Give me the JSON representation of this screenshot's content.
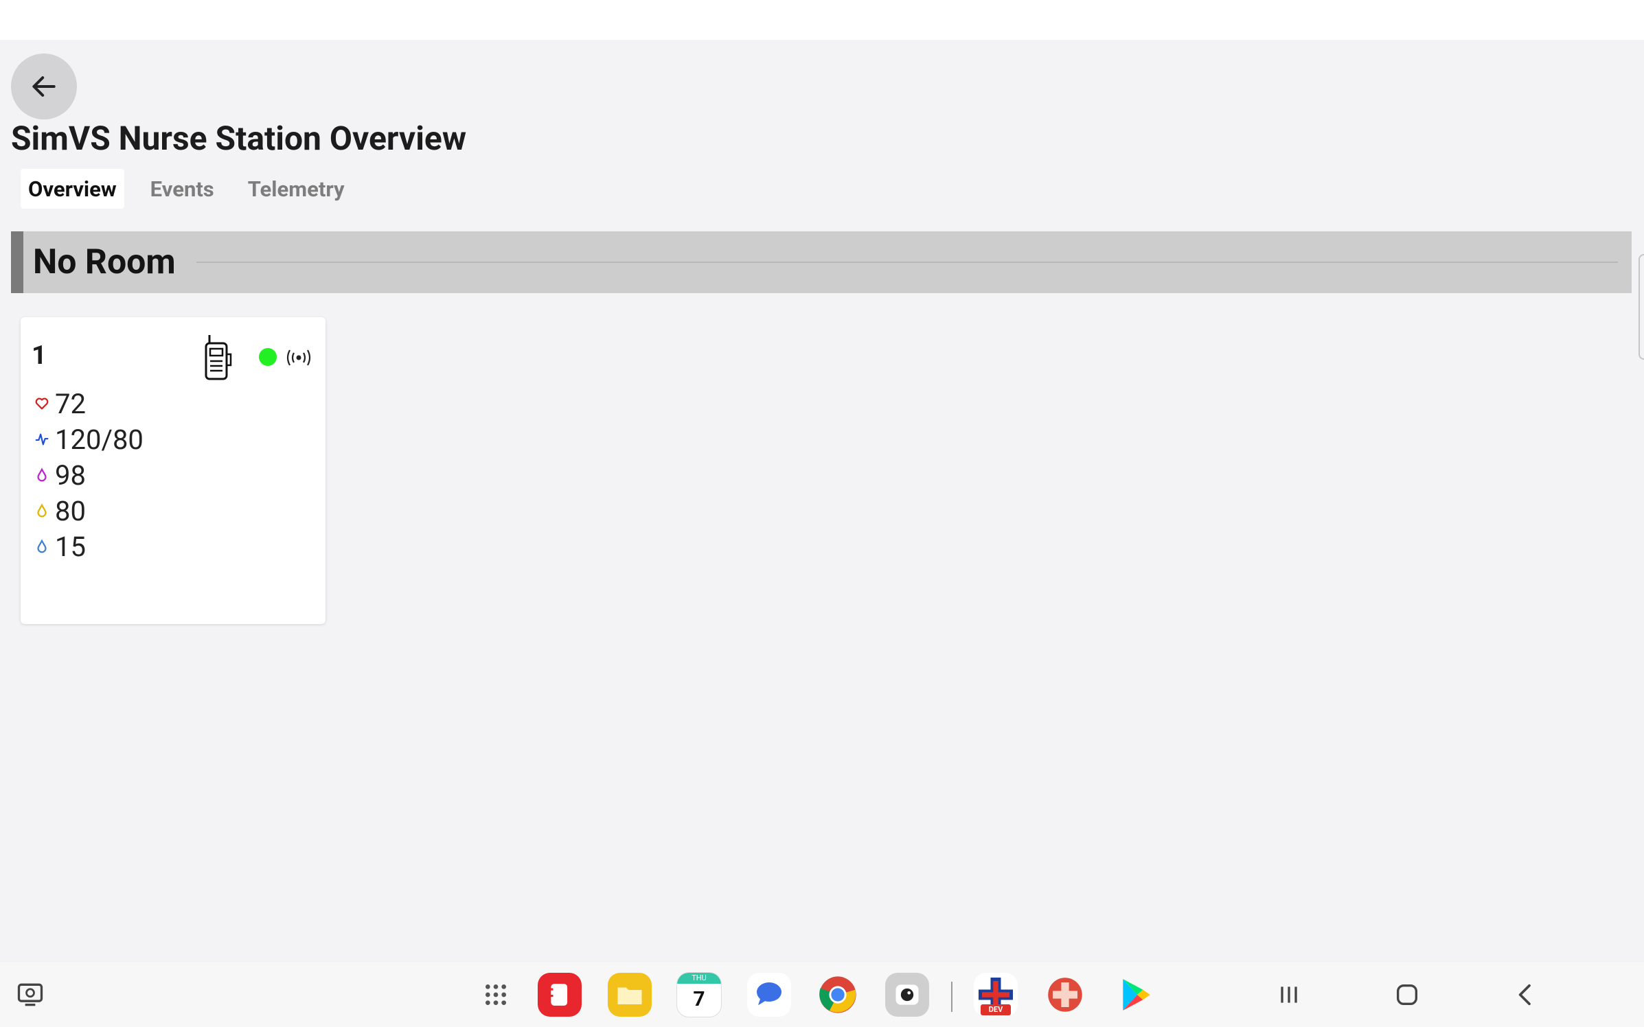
{
  "page": {
    "title": "SimVS Nurse Station Overview"
  },
  "tabs": [
    {
      "label": "Overview",
      "active": true
    },
    {
      "label": "Events",
      "active": false
    },
    {
      "label": "Telemetry",
      "active": false
    }
  ],
  "room": {
    "title": "No Room"
  },
  "patient_card": {
    "id": "1",
    "status_color": "#22f022",
    "device_icon": "telemetry-device-icon",
    "signal_icon": "broadcast-signal-icon",
    "vitals": [
      {
        "name": "heart-rate",
        "icon": "heart-icon",
        "color": "#d21f1f",
        "value": "72"
      },
      {
        "name": "blood-pressure",
        "icon": "pulse-wave-icon",
        "color": "#1f4fd2",
        "value": "120/80"
      },
      {
        "name": "spo2",
        "icon": "drop-icon",
        "color": "#c21fd2",
        "value": "98"
      },
      {
        "name": "vital-4",
        "icon": "drop-icon",
        "color": "#e0b400",
        "value": "80"
      },
      {
        "name": "respiration",
        "icon": "drop-icon",
        "color": "#3f7fd2",
        "value": "15"
      }
    ]
  },
  "taskbar": {
    "calendar_day": "THU",
    "calendar_date": "7",
    "dev_badge": "DEV",
    "apps": [
      "app-drawer-icon",
      "notes-app-icon",
      "files-app-icon",
      "calendar-app-icon",
      "messages-app-icon",
      "chrome-app-icon",
      "camera-app-icon",
      "simvs-dev-app-icon",
      "simvs-app-icon",
      "play-store-app-icon"
    ]
  }
}
